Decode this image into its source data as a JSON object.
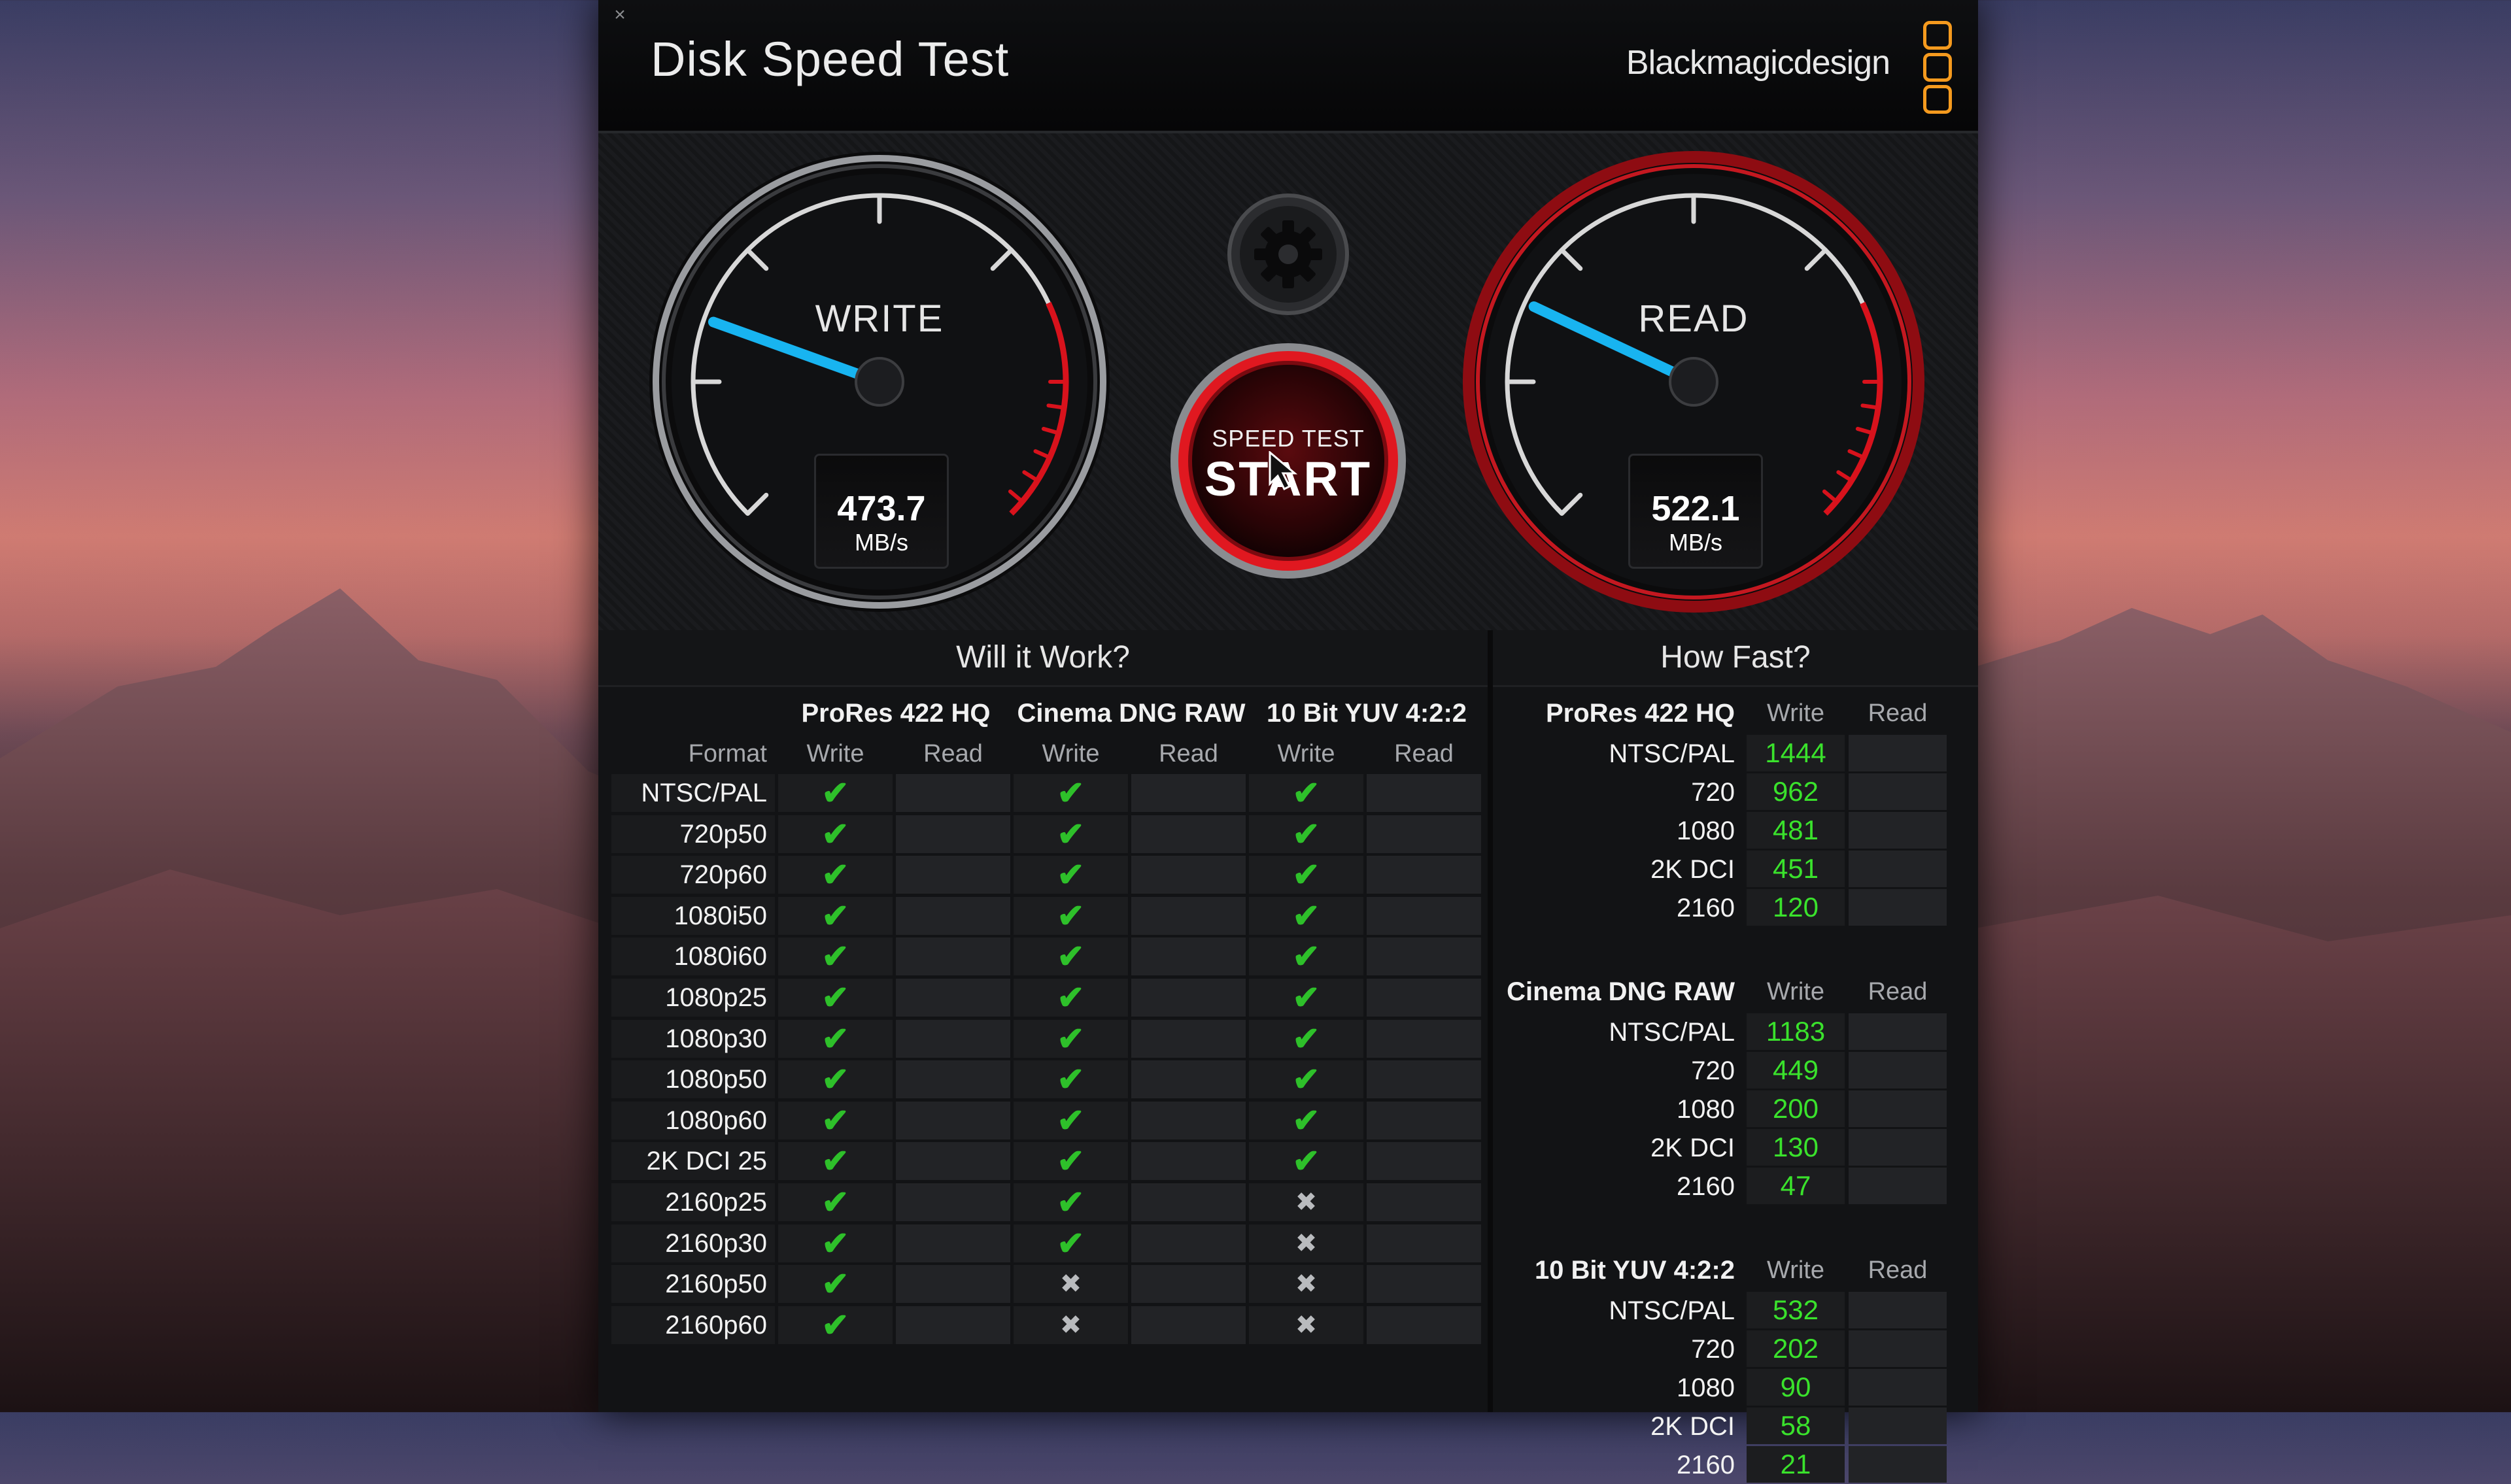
{
  "window": {
    "close_label": "×",
    "title": "Disk Speed Test",
    "brand": "Blackmagicdesign"
  },
  "write_gauge": {
    "label": "WRITE",
    "value": "473.7",
    "unit": "MB/s",
    "needle_fraction": 0.24,
    "needle_color": "#18b4f0"
  },
  "read_gauge": {
    "label": "READ",
    "value": "522.1",
    "unit": "MB/s",
    "needle_fraction": 0.26,
    "needle_color": "#18b4f0"
  },
  "start_button": {
    "small_label": "SPEED TEST",
    "big_label": "START"
  },
  "will_it_work": {
    "title": "Will it Work?",
    "format_label": "Format",
    "groups": [
      "ProRes 422 HQ",
      "Cinema DNG RAW",
      "10 Bit YUV 4:2:2"
    ],
    "sub_labels": [
      "Write",
      "Read",
      "Write",
      "Read",
      "Write",
      "Read"
    ],
    "rows": [
      {
        "format": "NTSC/PAL",
        "results": [
          "ok",
          "",
          "ok",
          "",
          "ok",
          ""
        ]
      },
      {
        "format": "720p50",
        "results": [
          "ok",
          "",
          "ok",
          "",
          "ok",
          ""
        ]
      },
      {
        "format": "720p60",
        "results": [
          "ok",
          "",
          "ok",
          "",
          "ok",
          ""
        ]
      },
      {
        "format": "1080i50",
        "results": [
          "ok",
          "",
          "ok",
          "",
          "ok",
          ""
        ]
      },
      {
        "format": "1080i60",
        "results": [
          "ok",
          "",
          "ok",
          "",
          "ok",
          ""
        ]
      },
      {
        "format": "1080p25",
        "results": [
          "ok",
          "",
          "ok",
          "",
          "ok",
          ""
        ]
      },
      {
        "format": "1080p30",
        "results": [
          "ok",
          "",
          "ok",
          "",
          "ok",
          ""
        ]
      },
      {
        "format": "1080p50",
        "results": [
          "ok",
          "",
          "ok",
          "",
          "ok",
          ""
        ]
      },
      {
        "format": "1080p60",
        "results": [
          "ok",
          "",
          "ok",
          "",
          "ok",
          ""
        ]
      },
      {
        "format": "2K DCI 25",
        "results": [
          "ok",
          "",
          "ok",
          "",
          "ok",
          ""
        ]
      },
      {
        "format": "2160p25",
        "results": [
          "ok",
          "",
          "ok",
          "",
          "x",
          ""
        ]
      },
      {
        "format": "2160p30",
        "results": [
          "ok",
          "",
          "ok",
          "",
          "x",
          ""
        ]
      },
      {
        "format": "2160p50",
        "results": [
          "ok",
          "",
          "x",
          "",
          "x",
          ""
        ]
      },
      {
        "format": "2160p60",
        "results": [
          "ok",
          "",
          "x",
          "",
          "x",
          ""
        ]
      }
    ],
    "check_glyph": "✔",
    "cross_glyph": "✖"
  },
  "how_fast": {
    "title": "How Fast?",
    "blocks": [
      {
        "title": "ProRes 422 HQ",
        "write_label": "Write",
        "read_label": "Read",
        "rows": [
          {
            "label": "NTSC/PAL",
            "write": "1444",
            "read": ""
          },
          {
            "label": "720",
            "write": "962",
            "read": ""
          },
          {
            "label": "1080",
            "write": "481",
            "read": ""
          },
          {
            "label": "2K DCI",
            "write": "451",
            "read": ""
          },
          {
            "label": "2160",
            "write": "120",
            "read": ""
          }
        ]
      },
      {
        "title": "Cinema DNG RAW",
        "write_label": "Write",
        "read_label": "Read",
        "rows": [
          {
            "label": "NTSC/PAL",
            "write": "1183",
            "read": ""
          },
          {
            "label": "720",
            "write": "449",
            "read": ""
          },
          {
            "label": "1080",
            "write": "200",
            "read": ""
          },
          {
            "label": "2K DCI",
            "write": "130",
            "read": ""
          },
          {
            "label": "2160",
            "write": "47",
            "read": ""
          }
        ]
      },
      {
        "title": "10 Bit YUV 4:2:2",
        "write_label": "Write",
        "read_label": "Read",
        "rows": [
          {
            "label": "NTSC/PAL",
            "write": "532",
            "read": ""
          },
          {
            "label": "720",
            "write": "202",
            "read": ""
          },
          {
            "label": "1080",
            "write": "90",
            "read": ""
          },
          {
            "label": "2K DCI",
            "write": "58",
            "read": ""
          },
          {
            "label": "2160",
            "write": "21",
            "read": ""
          }
        ]
      }
    ]
  },
  "colors": {
    "accent_red": "#c0141c",
    "ok_green": "#2ec02a",
    "value_green": "#3ae22c",
    "brand_orange": "#f59a1e",
    "needle_blue": "#18b4f0"
  }
}
